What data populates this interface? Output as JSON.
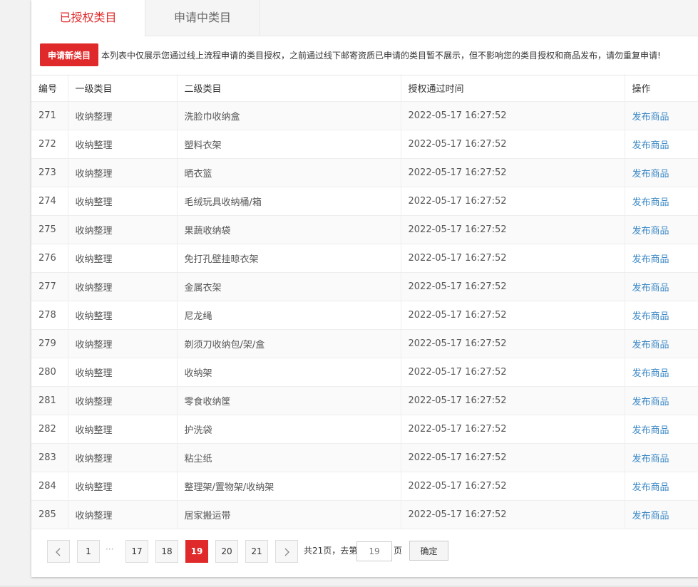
{
  "tabs": [
    {
      "label": "已授权类目",
      "active": true
    },
    {
      "label": "申请中类目",
      "active": false
    }
  ],
  "notice": {
    "apply_button": "申请新类目",
    "text": "本列表中仅展示您通过线上流程申请的类目授权，之前通过线下邮寄资质已申请的类目暂不展示，但不影响您的类目授权和商品发布，请勿重复申请!"
  },
  "table": {
    "columns": [
      "编号",
      "一级类目",
      "二级类目",
      "授权通过时间",
      "操作"
    ],
    "rows": [
      {
        "id": "271",
        "level1": "收纳整理",
        "level2": "洗脸巾收纳盒",
        "time": "2022-05-17 16:27:52",
        "action": "发布商品"
      },
      {
        "id": "272",
        "level1": "收纳整理",
        "level2": "塑料衣架",
        "time": "2022-05-17 16:27:52",
        "action": "发布商品"
      },
      {
        "id": "273",
        "level1": "收纳整理",
        "level2": "晒衣篮",
        "time": "2022-05-17 16:27:52",
        "action": "发布商品"
      },
      {
        "id": "274",
        "level1": "收纳整理",
        "level2": "毛绒玩具收纳桶/箱",
        "time": "2022-05-17 16:27:52",
        "action": "发布商品"
      },
      {
        "id": "275",
        "level1": "收纳整理",
        "level2": "果蔬收纳袋",
        "time": "2022-05-17 16:27:52",
        "action": "发布商品"
      },
      {
        "id": "276",
        "level1": "收纳整理",
        "level2": "免打孔壁挂晾衣架",
        "time": "2022-05-17 16:27:52",
        "action": "发布商品"
      },
      {
        "id": "277",
        "level1": "收纳整理",
        "level2": "金属衣架",
        "time": "2022-05-17 16:27:52",
        "action": "发布商品"
      },
      {
        "id": "278",
        "level1": "收纳整理",
        "level2": "尼龙绳",
        "time": "2022-05-17 16:27:52",
        "action": "发布商品"
      },
      {
        "id": "279",
        "level1": "收纳整理",
        "level2": "剃须刀收纳包/架/盒",
        "time": "2022-05-17 16:27:52",
        "action": "发布商品"
      },
      {
        "id": "280",
        "level1": "收纳整理",
        "level2": "收纳架",
        "time": "2022-05-17 16:27:52",
        "action": "发布商品"
      },
      {
        "id": "281",
        "level1": "收纳整理",
        "level2": "零食收纳筐",
        "time": "2022-05-17 16:27:52",
        "action": "发布商品"
      },
      {
        "id": "282",
        "level1": "收纳整理",
        "level2": "护洗袋",
        "time": "2022-05-17 16:27:52",
        "action": "发布商品"
      },
      {
        "id": "283",
        "level1": "收纳整理",
        "level2": "粘尘纸",
        "time": "2022-05-17 16:27:52",
        "action": "发布商品"
      },
      {
        "id": "284",
        "level1": "收纳整理",
        "level2": "整理架/置物架/收纳架",
        "time": "2022-05-17 16:27:52",
        "action": "发布商品"
      },
      {
        "id": "285",
        "level1": "收纳整理",
        "level2": "居家搬运带",
        "time": "2022-05-17 16:27:52",
        "action": "发布商品"
      }
    ]
  },
  "pagination": {
    "prev_icon": "chevron-left-icon",
    "next_icon": "chevron-right-icon",
    "pages": [
      "1",
      "17",
      "18",
      "19",
      "20",
      "21"
    ],
    "ellipsis": "···",
    "current": "19",
    "total_label": "共21页，去第",
    "page_suffix": "页",
    "goto_placeholder": "19",
    "confirm_label": "确定"
  },
  "colors": {
    "accent": "#e0292a",
    "link": "#3b88c6"
  }
}
